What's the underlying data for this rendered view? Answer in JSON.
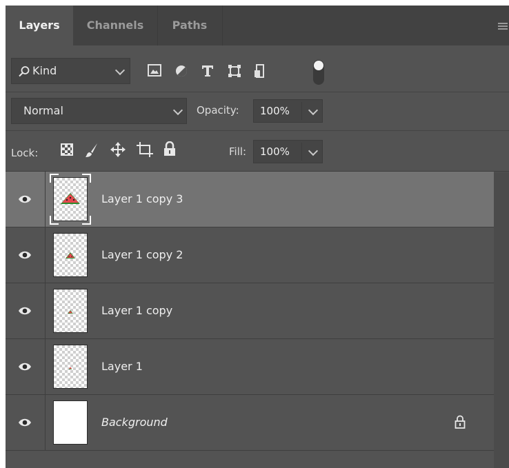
{
  "tabs": [
    {
      "label": "Layers",
      "active": true
    },
    {
      "label": "Channels",
      "active": false
    },
    {
      "label": "Paths",
      "active": false
    }
  ],
  "filter": {
    "label": "Kind",
    "icons": [
      "image-filter-icon",
      "adjustment-filter-icon",
      "type-filter-icon",
      "shape-filter-icon",
      "smart-object-filter-icon",
      "filter-toggle-icon"
    ]
  },
  "blend": {
    "mode": "Normal",
    "opacity_label": "Opacity:",
    "opacity_value": "100%"
  },
  "lock": {
    "label": "Lock:",
    "fill_label": "Fill:",
    "fill_value": "100%"
  },
  "layers": [
    {
      "name": "Layer 1 copy 3",
      "selected": true,
      "italic": false,
      "locked": false,
      "thumb": "watermelon-large"
    },
    {
      "name": "Layer 1 copy 2",
      "selected": false,
      "italic": false,
      "locked": false,
      "thumb": "watermelon-medium"
    },
    {
      "name": "Layer 1 copy",
      "selected": false,
      "italic": false,
      "locked": false,
      "thumb": "watermelon-small"
    },
    {
      "name": "Layer 1",
      "selected": false,
      "italic": false,
      "locked": false,
      "thumb": "watermelon-tiny"
    },
    {
      "name": "Background",
      "selected": false,
      "italic": true,
      "locked": true,
      "thumb": "white"
    }
  ],
  "colors": {
    "panel": "#535353",
    "tabbar": "#424242",
    "selected_row": "#737373",
    "watermelon_flesh": "#e8474f",
    "watermelon_rind": "#2e8b2e"
  }
}
